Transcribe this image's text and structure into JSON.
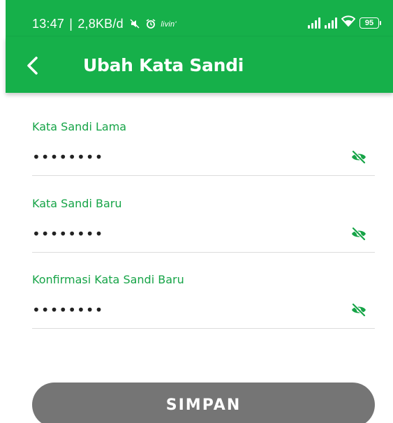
{
  "statusbar": {
    "time": "13:47",
    "separator": "|",
    "network_speed": "2,8KB/d",
    "app_indicator": "livin'",
    "battery": "95",
    "icons": [
      "mute-icon",
      "alarm-icon",
      "signal-icon",
      "signal-icon",
      "wifi-icon",
      "battery-icon"
    ]
  },
  "appbar": {
    "title": "Ubah Kata Sandi",
    "back_icon": "chevron-left-icon"
  },
  "form": {
    "fields": [
      {
        "label": "Kata Sandi Lama",
        "value": "••••••••",
        "icon": "eye-off-icon"
      },
      {
        "label": "Kata Sandi Baru",
        "value": "••••••••",
        "icon": "eye-off-icon"
      },
      {
        "label": "Konfirmasi Kata Sandi Baru",
        "value": "••••••••",
        "icon": "eye-off-icon"
      }
    ],
    "submit_label": "SIMPAN"
  },
  "colors": {
    "primary": "#16b04a",
    "label": "#16a447",
    "button": "#757575"
  }
}
